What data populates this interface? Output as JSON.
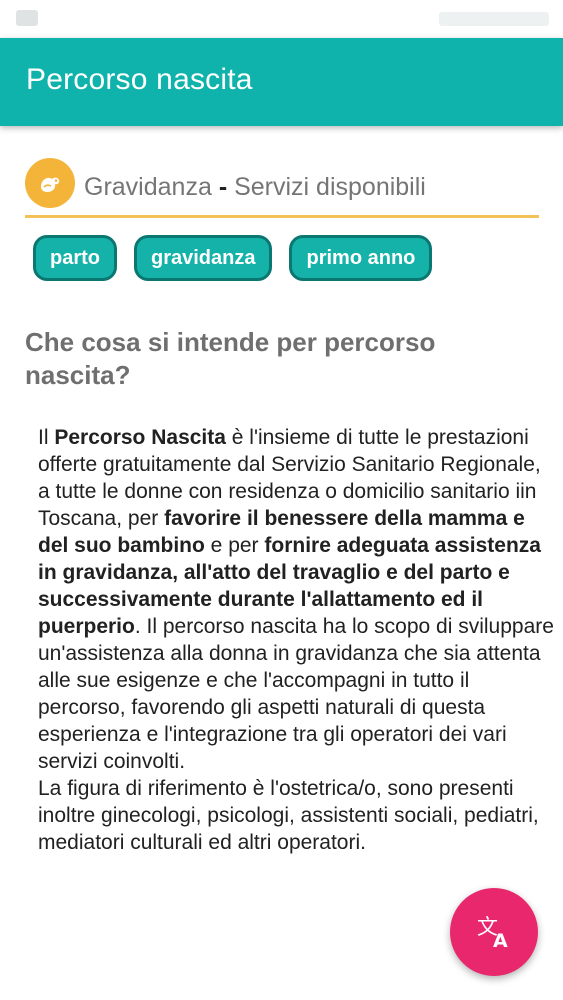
{
  "app": {
    "title": "Percorso nascita"
  },
  "section": {
    "category": "Gravidanza",
    "separator": "-",
    "subtitle": "Servizi disponibili",
    "icon": "baby-icon"
  },
  "chips": [
    {
      "label": "parto"
    },
    {
      "label": "gravidanza"
    },
    {
      "label": "primo anno"
    }
  ],
  "question": "Che cosa si intende per percorso nascita?",
  "body": {
    "p1_start": "Il ",
    "p1_bold1": "Percorso Nascita",
    "p1_mid1": " è l'insieme di tutte le prestazioni offerte gratuitamente dal Servizio Sanitario Regionale, a tutte le donne con residenza  o domicilio sanitario iin Toscana, per ",
    "p1_bold2": "favorire il benessere della mamma e del suo bambino",
    "p1_mid2": " e per ",
    "p1_bold3": "fornire adeguata assistenza in gravidanza, all'atto del travaglio e del parto e successivamente durante l'allattamento ed il puerperio",
    "p1_end": ". Il percorso nascita ha lo scopo di sviluppare un'assistenza alla donna in gravidanza che sia attenta alle sue esigenze e che l'accompagni in tutto il percorso, favorendo gli aspetti naturali di questa esperienza e l'integrazione tra gli operatori dei vari servizi coinvolti.",
    "p2": "La figura di riferimento è l'ostetrica/o, sono presenti inoltre ginecologi, psicologi, assistenti sociali, pediatri, mediatori culturali ed altri operatori."
  },
  "fab": {
    "icon": "translate-icon"
  },
  "colors": {
    "appbar": "#0fb3ac",
    "chip": "#15b2aa",
    "chip_border": "#0a7771",
    "accent_line": "#f2c158",
    "section_icon_bg": "#f4b43a",
    "fab": "#e9276c"
  }
}
